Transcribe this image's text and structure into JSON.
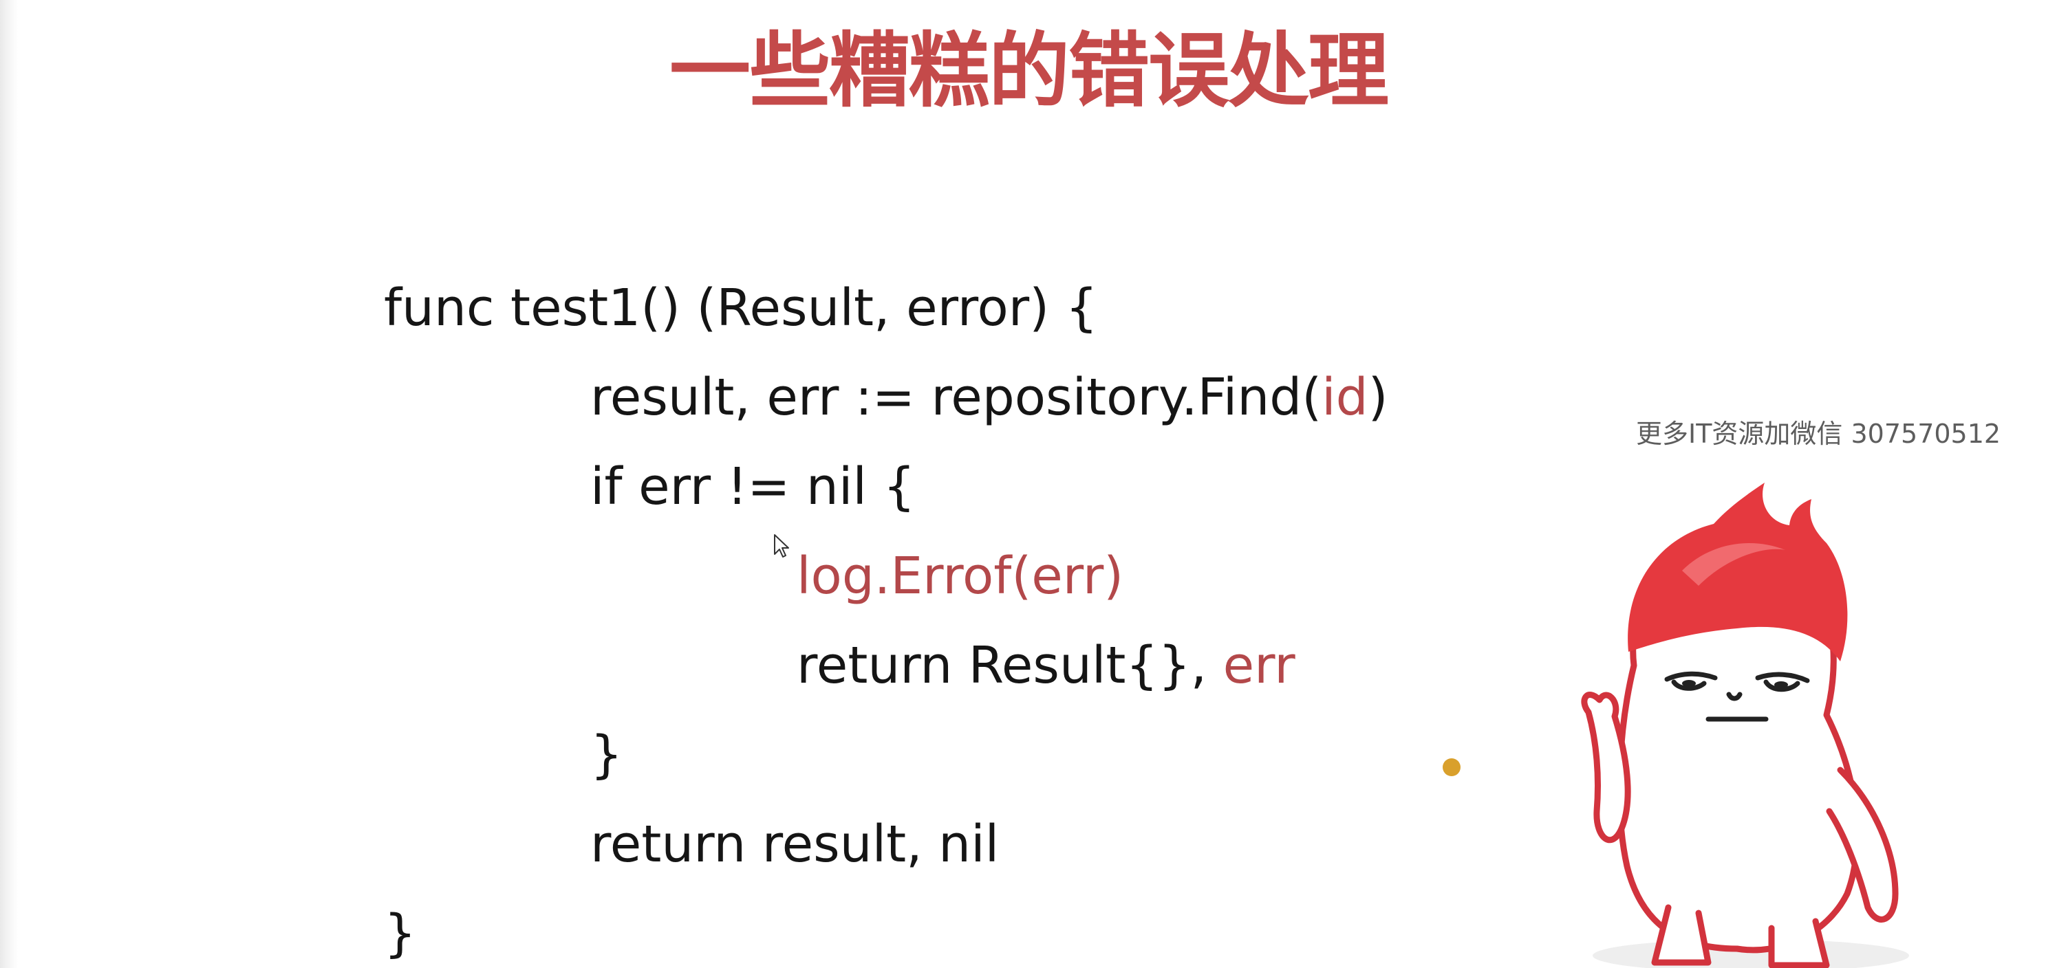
{
  "title": "一些糟糕的错误处理",
  "watermark": "更多IT资源加微信  307570512",
  "colors": {
    "title": "#c44a4a",
    "code": "#151515",
    "highlight": "#b3484a",
    "pointer_dot": "#d9a02c",
    "mascot_outline": "#d2333d",
    "mascot_hair": "#e5393f"
  },
  "code": {
    "line1": "func test1() (Result, error) {",
    "line2_a": "result, err := repository.Find(",
    "line2_b": "id",
    "line2_c": ")",
    "line3": "if err != nil {",
    "line4": "log.Errof(err)",
    "line5_a": "return Result{}, ",
    "line5_b": "err",
    "line6": "}",
    "line7": "return result, nil",
    "line8": "}"
  },
  "icons": {
    "cursor": "mouse-cursor-icon",
    "pointer": "pointer-dot",
    "mascot": "mascot-illustration"
  }
}
